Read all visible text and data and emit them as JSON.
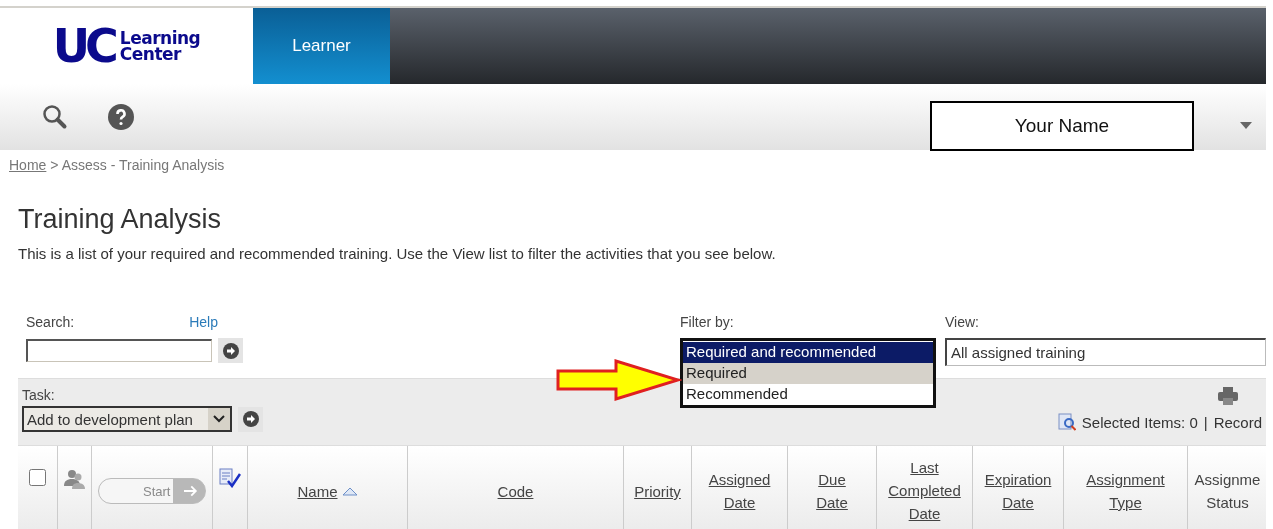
{
  "logo": {
    "mark": "UC",
    "lines": [
      "Learning",
      "Center"
    ]
  },
  "nav_tabs": [
    {
      "label": "Learner",
      "selected": true
    }
  ],
  "user_menu": {
    "name": "Your Name"
  },
  "breadcrumb": {
    "home": "Home",
    "rest": "> Assess - Training Analysis"
  },
  "page": {
    "title": "Training Analysis",
    "description": "This is a list of your required and recommended training. Use the View list to filter the activities that you see below."
  },
  "search": {
    "label": "Search:",
    "help": "Help"
  },
  "filter": {
    "label": "Filter by:",
    "options": [
      {
        "label": "Required and recommended",
        "selected": true,
        "hovered": false
      },
      {
        "label": "Required",
        "selected": false,
        "hovered": true
      },
      {
        "label": "Recommended",
        "selected": false,
        "hovered": false
      }
    ]
  },
  "view": {
    "label": "View:",
    "value": "All assigned training"
  },
  "task": {
    "label": "Task:",
    "value": "Add to development plan"
  },
  "selection": {
    "text": "Selected Items: 0",
    "separator": "|",
    "records": "Record"
  },
  "table": {
    "select_all": {
      "checked": false
    },
    "start_button": {
      "label": "Start",
      "disabled": true
    },
    "columns": [
      {
        "label": "Name",
        "link": true,
        "sorted": true
      },
      {
        "label": "Code",
        "link": true,
        "sorted": false
      },
      {
        "label": "Priority",
        "link": true,
        "sorted": false
      },
      {
        "label": "Assigned\nDate",
        "link": true,
        "sorted": false
      },
      {
        "label": "Due\nDate",
        "link": true,
        "sorted": false
      },
      {
        "label": "Last\nCompleted\nDate",
        "link": true,
        "sorted": false
      },
      {
        "label": "Expiration\nDate",
        "link": true,
        "sorted": false
      },
      {
        "label": "Assignment\nType",
        "link": true,
        "sorted": false
      },
      {
        "label": "Assignme\nStatus",
        "link": false,
        "sorted": false
      }
    ]
  }
}
